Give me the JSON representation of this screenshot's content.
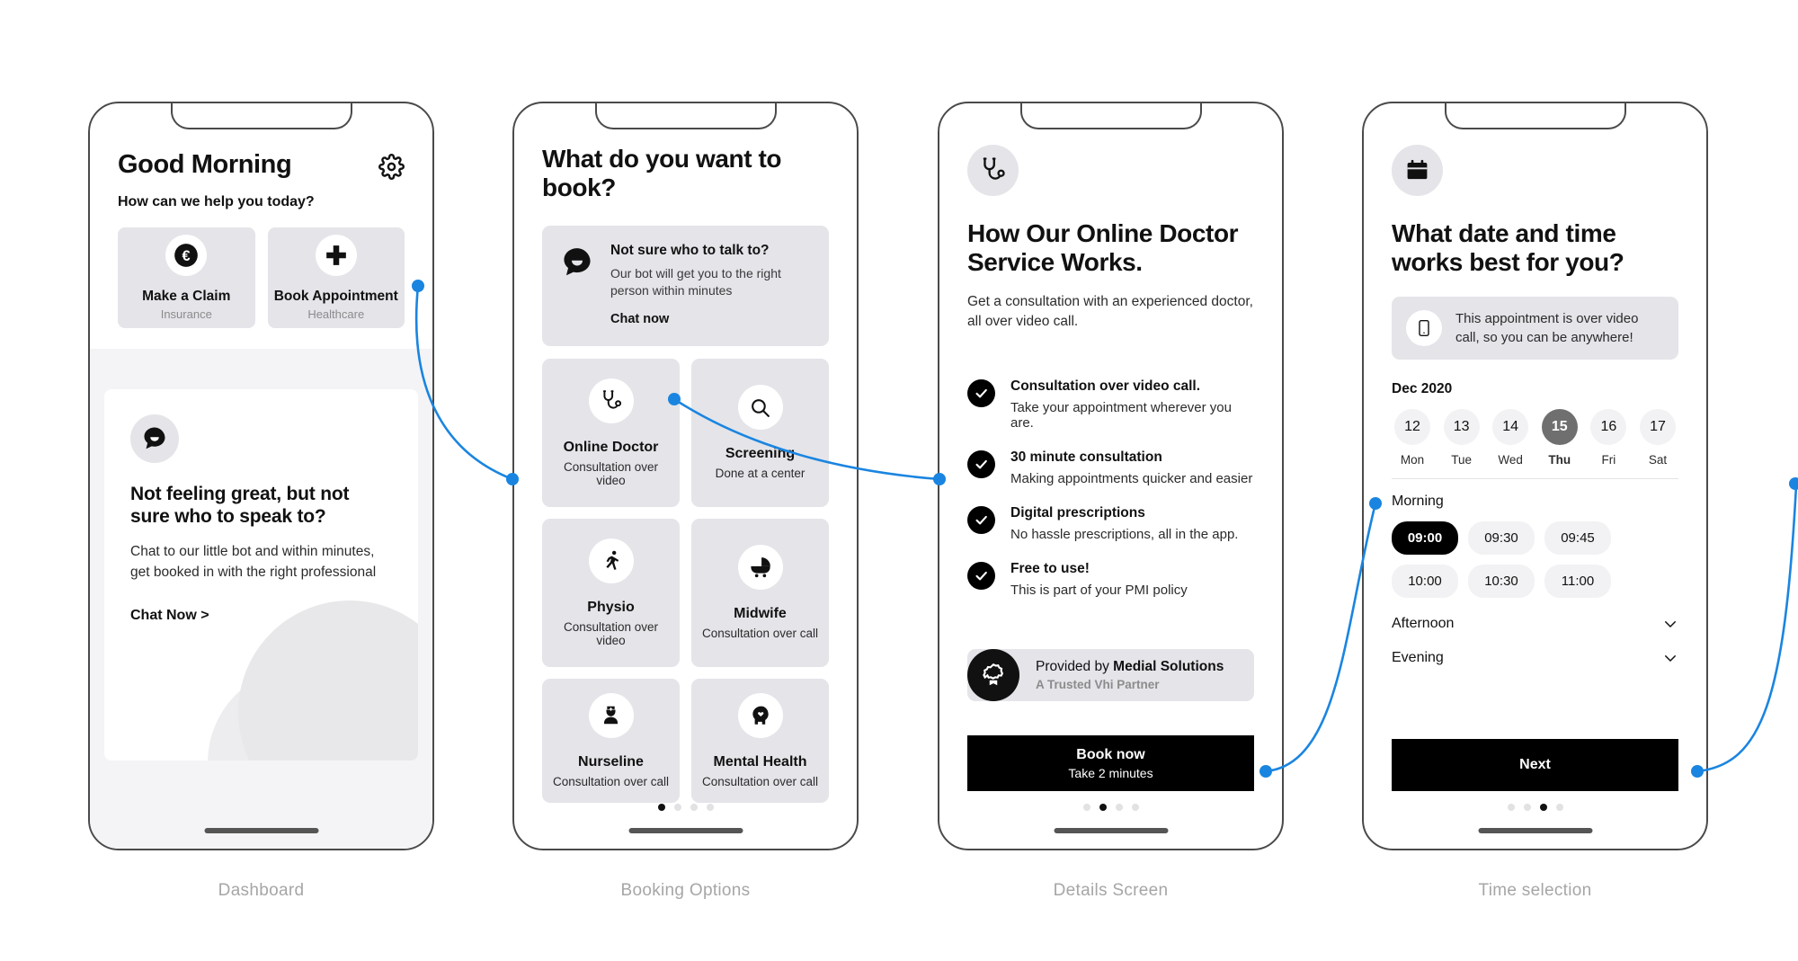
{
  "accent_color": "#1a85e0",
  "phones": [
    {
      "caption": "Dashboard",
      "greeting": "Good Morning",
      "help_line": "How can we help you today?",
      "settings_icon": "gear-icon",
      "tiles": [
        {
          "icon": "euro-coin-icon",
          "title": "Make a Claim",
          "subtitle": "Insurance"
        },
        {
          "icon": "medical-cross-icon",
          "title": "Book Appointment",
          "subtitle": "Healthcare"
        }
      ],
      "chat_card": {
        "icon": "chat-bubble-icon",
        "heading": "Not feeling great, but not sure who to speak to?",
        "body": "Chat to our little bot and within minutes, get booked in with the right professional",
        "cta": "Chat Now >"
      },
      "dots": {
        "count": 4,
        "active": -1
      }
    },
    {
      "caption": "Booking Options",
      "title": "What do you want to book?",
      "bot_card": {
        "icon": "chat-bubble-icon",
        "title": "Not sure who to talk to?",
        "body": "Our bot will get you to the right person within minutes",
        "cta": "Chat now"
      },
      "options": [
        {
          "icon": "stethoscope-icon",
          "title": "Online Doctor",
          "subtitle": "Consultation over video"
        },
        {
          "icon": "magnifier-icon",
          "title": "Screening",
          "subtitle": "Done at a center"
        },
        {
          "icon": "running-person-icon",
          "title": "Physio",
          "subtitle": "Consultation over video"
        },
        {
          "icon": "stroller-icon",
          "title": "Midwife",
          "subtitle": "Consultation over call"
        },
        {
          "icon": "nurse-icon",
          "title": "Nurseline",
          "subtitle": "Consultation over call"
        },
        {
          "icon": "head-heart-icon",
          "title": "Mental Health",
          "subtitle": "Consultation over call"
        }
      ],
      "dots": {
        "count": 4,
        "active": 0
      }
    },
    {
      "caption": "Details Screen",
      "header_icon": "stethoscope-icon",
      "title": "How Our Online Doctor Service Works.",
      "lead": "Get a consultation with an experienced doctor, all over video call.",
      "features": [
        {
          "icon": "check-circle-icon",
          "title": "Consultation over video call.",
          "subtitle": "Take your appointment wherever you are."
        },
        {
          "icon": "check-circle-icon",
          "title": "30 minute consultation",
          "subtitle": "Making appointments quicker and easier"
        },
        {
          "icon": "check-circle-icon",
          "title": "Digital prescriptions",
          "subtitle": "No hassle prescriptions, all in the app."
        },
        {
          "icon": "check-circle-icon",
          "title": "Free to use!",
          "subtitle": "This is part of your PMI policy"
        }
      ],
      "provider": {
        "icon": "award-rosette-icon",
        "prefix": "Provided by ",
        "name": "Medial Solutions",
        "subtitle": "A Trusted Vhi Partner"
      },
      "cta": {
        "label": "Book now",
        "sublabel": "Take 2 minutes"
      },
      "dots": {
        "count": 4,
        "active": 1
      }
    },
    {
      "caption": "Time selection",
      "header_icon": "calendar-icon",
      "title": "What date and time works best for you?",
      "note": {
        "icon": "phone-icon",
        "text": "This appointment is over video call, so you can be anywhere!"
      },
      "month": "Dec 2020",
      "days": [
        {
          "num": "12",
          "weekday": "Mon",
          "selected": false
        },
        {
          "num": "13",
          "weekday": "Tue",
          "selected": false
        },
        {
          "num": "14",
          "weekday": "Wed",
          "selected": false
        },
        {
          "num": "15",
          "weekday": "Thu",
          "selected": true
        },
        {
          "num": "16",
          "weekday": "Fri",
          "selected": false
        },
        {
          "num": "17",
          "weekday": "Sat",
          "selected": false
        }
      ],
      "morning_label": "Morning",
      "morning_slots": [
        {
          "time": "09:00",
          "selected": true
        },
        {
          "time": "09:30",
          "selected": false
        },
        {
          "time": "09:45",
          "selected": false
        },
        {
          "time": "10:00",
          "selected": false
        },
        {
          "time": "10:30",
          "selected": false
        },
        {
          "time": "11:00",
          "selected": false
        }
      ],
      "accordions": [
        {
          "label": "Afternoon",
          "icon": "chevron-down-icon"
        },
        {
          "label": "Evening",
          "icon": "chevron-down-icon"
        }
      ],
      "cta": {
        "label": "Next"
      },
      "dots": {
        "count": 4,
        "active": 2
      }
    }
  ]
}
